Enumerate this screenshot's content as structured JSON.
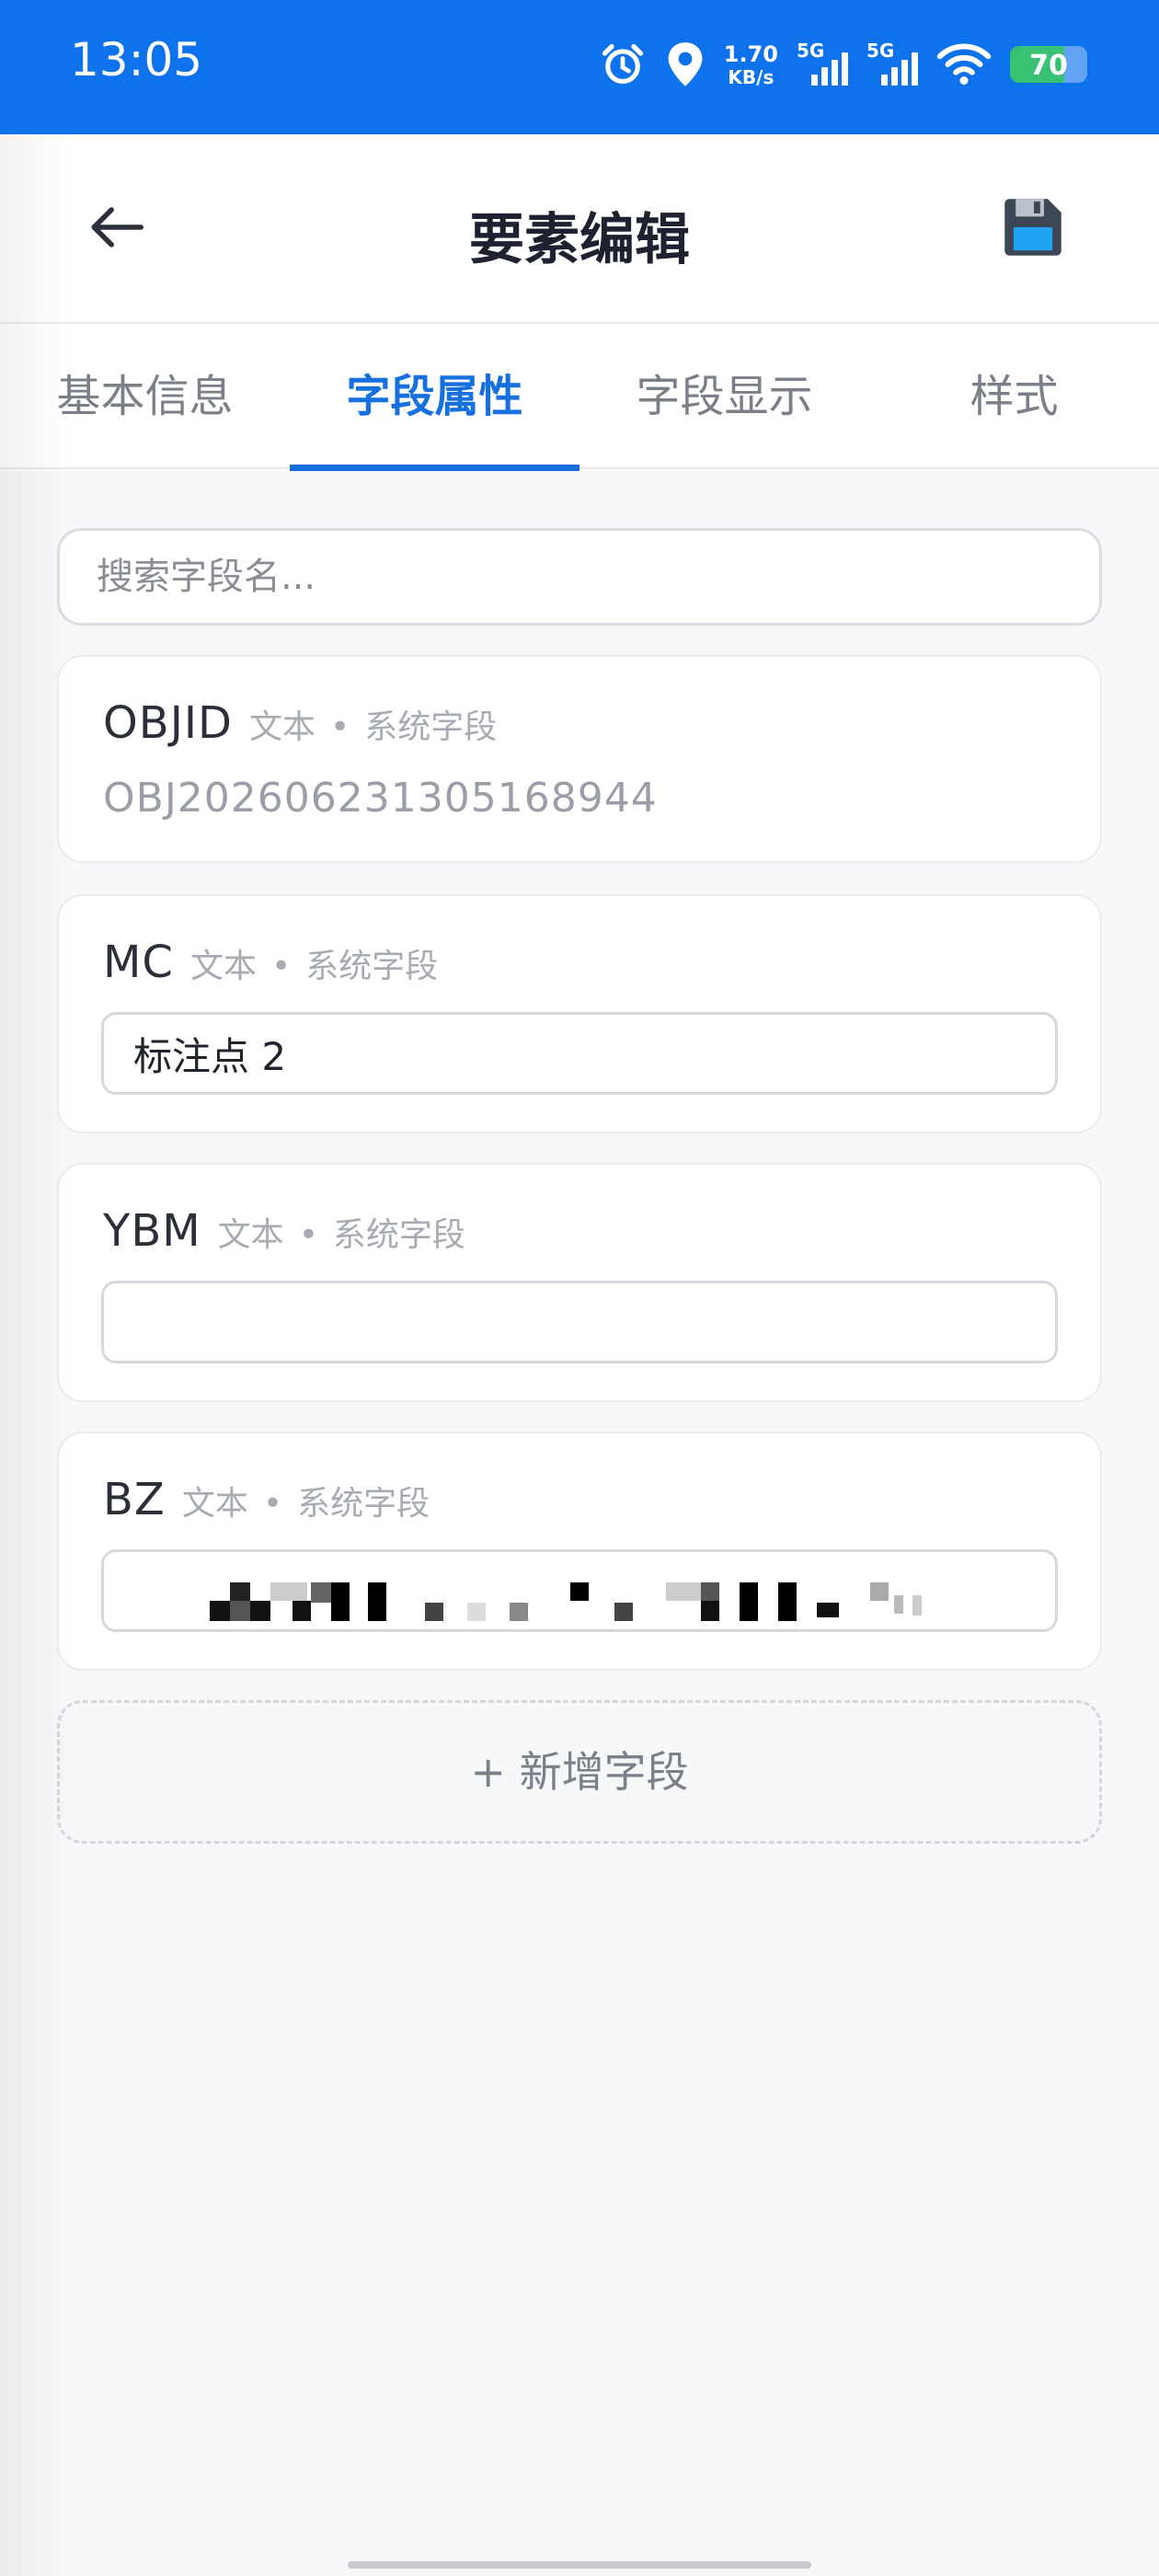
{
  "status_bar": {
    "time": "13:05",
    "icons": [
      "alarm-icon",
      "location-icon"
    ],
    "net_speed_value": "1.70",
    "net_speed_unit": "KB/s",
    "sim1_label": "5G",
    "sim2_label": "5G",
    "wifi_icon": "wifi-icon",
    "battery_text": "70",
    "battery_level": 0.7
  },
  "app_bar": {
    "title": "要素编辑",
    "back_icon": "arrow-left-icon",
    "save_icon": "floppy-disk-icon"
  },
  "tabs": [
    {
      "label": "基本信息",
      "active": false
    },
    {
      "label": "字段属性",
      "active": true
    },
    {
      "label": "字段显示",
      "active": false
    },
    {
      "label": "样式",
      "active": false
    }
  ],
  "search": {
    "placeholder": "搜索字段名..."
  },
  "fields": [
    {
      "name": "OBJID",
      "type": "文本",
      "kind": "系统字段",
      "value": "OBJ202606231305168944",
      "editable": false
    },
    {
      "name": "MC",
      "type": "文本",
      "kind": "系统字段",
      "value": "标注点 2",
      "editable": true
    },
    {
      "name": "YBM",
      "type": "文本",
      "kind": "系统字段",
      "value": "",
      "editable": true
    },
    {
      "name": "BZ",
      "type": "文本",
      "kind": "系统字段",
      "value": "",
      "editable": true
    }
  ],
  "meta_separator": "•",
  "add_field_label": "+ 新增字段",
  "colors": {
    "status_bar": "#0d72eb",
    "accent": "#1670e0",
    "card_border": "#ececf0",
    "background": "#f7f8fa"
  }
}
